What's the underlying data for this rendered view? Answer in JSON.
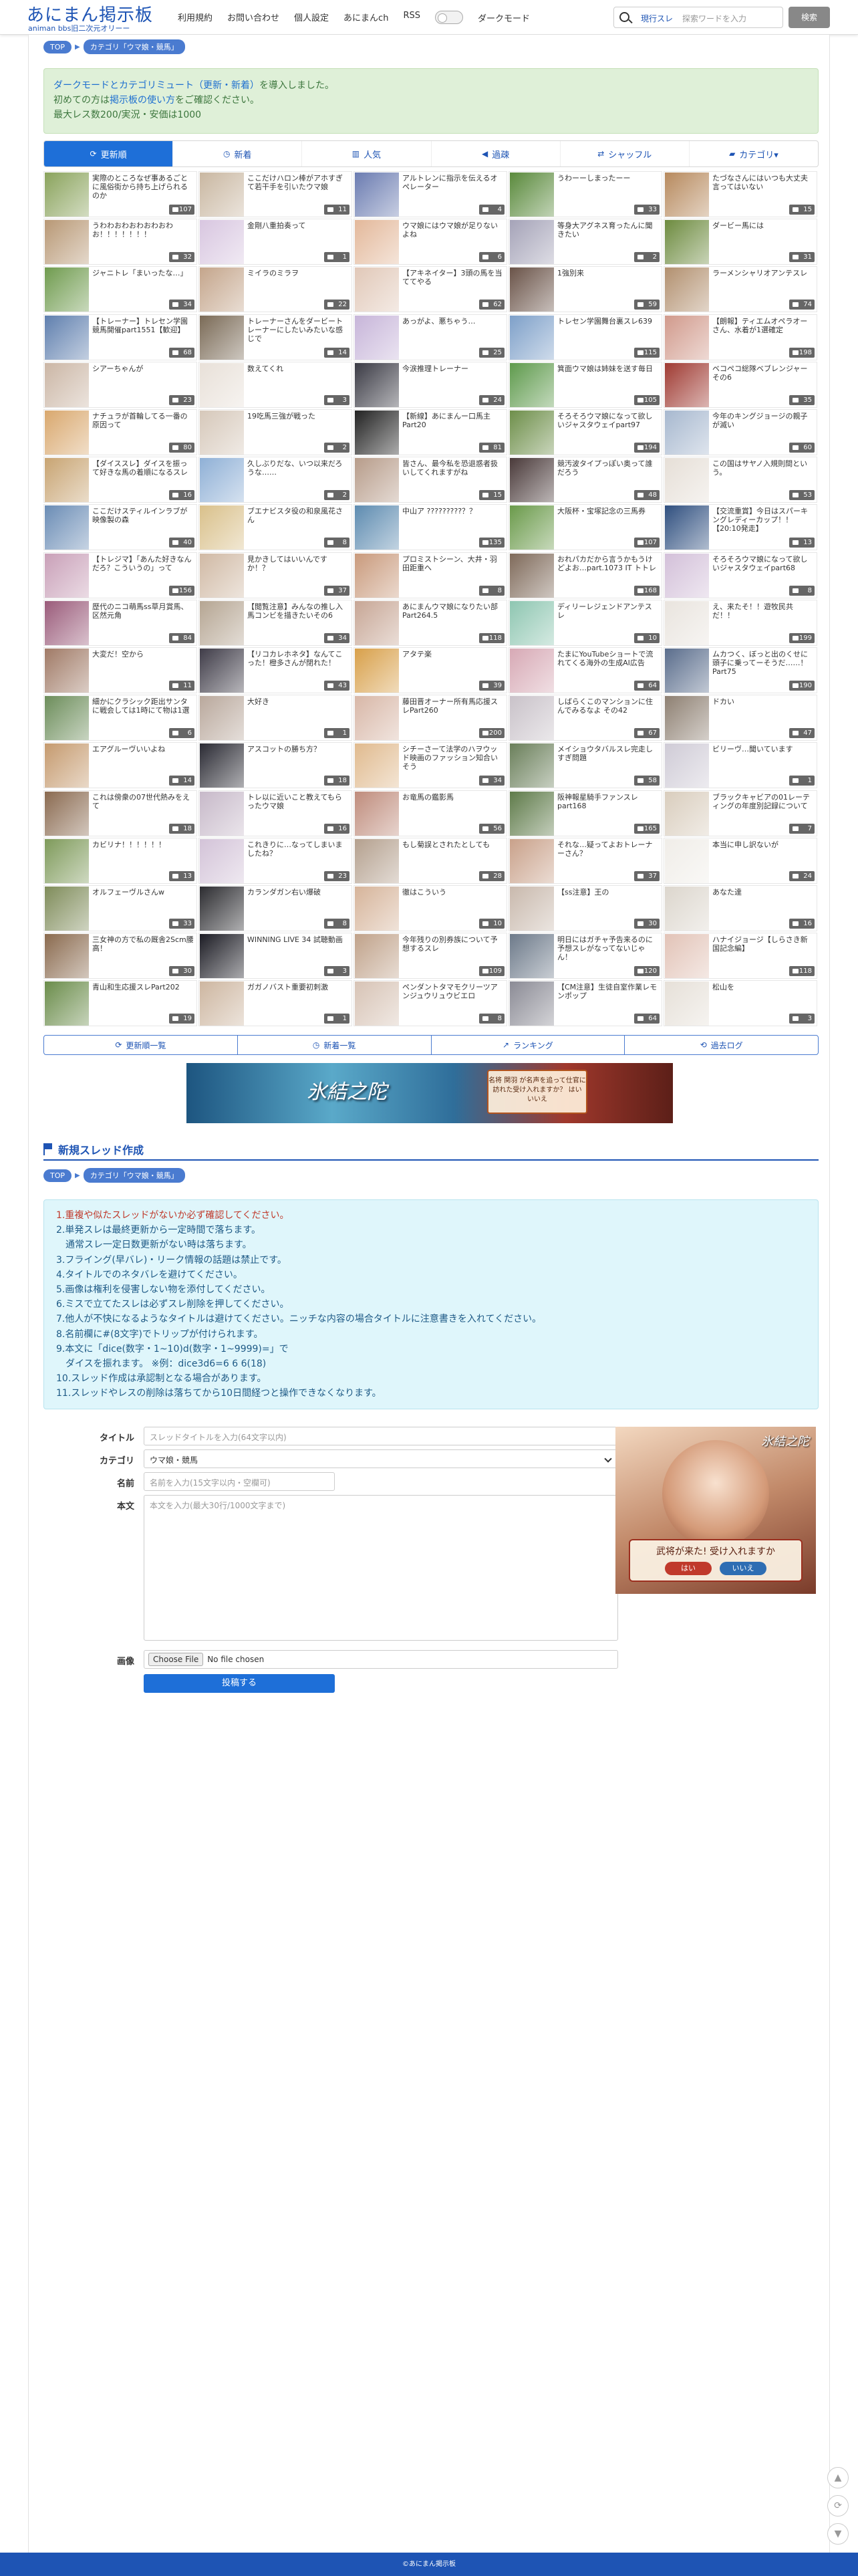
{
  "header": {
    "logo_main": "あにまん掲示板",
    "logo_sub": "animan bbs旧二次元オリーー",
    "nav": [
      "利用規約",
      "お問い合わせ",
      "個人設定",
      "あにまんch",
      "RSS"
    ],
    "darkmode_label": "ダークモード",
    "search_scope": "現行スレ",
    "search_placeholder": "探索ワードを入力",
    "search_button": "検索"
  },
  "breadcrumb": {
    "top": "TOP",
    "category": "カテゴリ「ウマ娘・競馬」"
  },
  "notice": {
    "line1_link": "ダークモードとカテゴリミュート（更新・新着）",
    "line1_rest": "を導入しました。",
    "line2_pre": "初めての方は",
    "line2_link": "掲示板の使い方",
    "line2_post": "をご確認ください。",
    "line3": "最大レス数200/実況・安価は1000"
  },
  "tabs": [
    {
      "label": "更新順",
      "icon": "refresh-icon",
      "active": true
    },
    {
      "label": "新着",
      "icon": "clock-icon",
      "active": false
    },
    {
      "label": "人気",
      "icon": "bar-chart-icon",
      "active": false
    },
    {
      "label": "過疎",
      "icon": "speaker-icon",
      "active": false
    },
    {
      "label": "シャッフル",
      "icon": "shuffle-icon",
      "active": false
    },
    {
      "label": "カテゴリ▾",
      "icon": "folder-icon",
      "active": false
    }
  ],
  "threads": [
    {
      "t": "実際のところなぜ事あるごとに風俗街から持ち上げられるのか",
      "n": "107",
      "c": "#8aa35c"
    },
    {
      "t": "ここだけハロン棒がアホすぎて若干手を引いたウマ娘",
      "n": "11",
      "c": "#c9b7a1"
    },
    {
      "t": "アルトレンに指示を伝えるオペレーター",
      "n": "4",
      "c": "#6b7cb1"
    },
    {
      "t": "うわーーしまったーー",
      "n": "33",
      "c": "#5a8a3c"
    },
    {
      "t": "たづなさんにはいつも大丈夫言ってはいない",
      "n": "15",
      "c": "#b78a5e"
    },
    {
      "t": "うわわおわおわおわおわお！！！！！！！",
      "n": "32",
      "c": "#b89875"
    },
    {
      "t": "金剛八重拍奏って",
      "n": "1",
      "c": "#d8c6e0"
    },
    {
      "t": "ウマ娘にはウマ娘が足りないよね",
      "n": "6",
      "c": "#e3b89a"
    },
    {
      "t": "等身大アグネス育ったんに聞きたい",
      "n": "2",
      "c": "#a5a3b8"
    },
    {
      "t": "ダービー馬には",
      "n": "31",
      "c": "#6d8b3f"
    },
    {
      "t": "ジャニトレ「まいったな…」",
      "n": "34",
      "c": "#6f9b4e"
    },
    {
      "t": "ミイラのミラヲ",
      "n": "22",
      "c": "#c4a58b"
    },
    {
      "t": "【アキネイター】3頭の馬を当ててやる",
      "n": "62",
      "c": "#e1c8b8"
    },
    {
      "t": "1強別来",
      "n": "59",
      "c": "#6a5348"
    },
    {
      "t": "ラーメンシャリオアンテスレ",
      "n": "74",
      "c": "#b2906f"
    },
    {
      "t": "【トレーナー】トレセン学園競馬開催part1551【歓迎】",
      "n": "68",
      "c": "#5f7fae"
    },
    {
      "t": "トレーナーさんをダービートレーナーにしたいみたいな感じで",
      "n": "14",
      "c": "#7a6a56"
    },
    {
      "t": "あっがよ、悪ちゃう…",
      "n": "25",
      "c": "#c7b5d9"
    },
    {
      "t": "トレセン学園舞台裏スレ639",
      "n": "115",
      "c": "#7ea0c9"
    },
    {
      "t": "【朗報】ティエムオペラオーさん、水着が1選確定",
      "n": "198",
      "c": "#d19a8c"
    },
    {
      "t": "シアーちゃんが",
      "n": "23",
      "c": "#cbb6a5"
    },
    {
      "t": "数えてくれ",
      "n": "3",
      "c": "#e8e0d8"
    },
    {
      "t": "今涙推理トレーナー",
      "n": "24",
      "c": "#3a3a44"
    },
    {
      "t": "箕面ウマ娘は姉妹を送す毎日",
      "n": "105",
      "c": "#5e9a4c"
    },
    {
      "t": "ベコペコ総隊ベブレンジャーその6",
      "n": "35",
      "c": "#9f3a32"
    },
    {
      "t": "ナチュラが首輪してる一番の原因って",
      "n": "80",
      "c": "#d9a86e"
    },
    {
      "t": "19吃馬三強が戦った",
      "n": "2",
      "c": "#d6c8ba"
    },
    {
      "t": "【新線】あにまんー口馬主 Part20",
      "n": "81",
      "c": "#222222"
    },
    {
      "t": "そろそろウマ娘になって欲しいジャスタウェイpart97",
      "n": "194",
      "c": "#6e8f4a"
    },
    {
      "t": "今年のキングジョージの親子が滅い",
      "n": "60",
      "c": "#a7b8cf"
    },
    {
      "t": "【ダイススレ】ダイスを振って好きな馬の着順になるスレ",
      "n": "16",
      "c": "#c8a472"
    },
    {
      "t": "久しぶりだな、いつ以来だろうな……",
      "n": "2",
      "c": "#8fb0d6"
    },
    {
      "t": "皆さん、最今私を恐退惑者扱いしてくれますがね",
      "n": "15",
      "c": "#b79c8a"
    },
    {
      "t": "競汚波タイプっぽい奥って誰だろう",
      "n": "48",
      "c": "#4a3a3a"
    },
    {
      "t": "この国はサヤノ入規則間という。",
      "n": "53",
      "c": "#e6dfd7"
    },
    {
      "t": "ここだけスティルインラブが映像製の森",
      "n": "40",
      "c": "#6a8cb5"
    },
    {
      "t": "ブエナビスタ役の和泉風花さん",
      "n": "8",
      "c": "#d9c08a"
    },
    {
      "t": "中山ア ?????????？？",
      "n": "135",
      "c": "#5d8bb0"
    },
    {
      "t": "大阪杯・宝塚記念の三馬券",
      "n": "107",
      "c": "#6a9a4a"
    },
    {
      "t": "【交流重賞】今日はスパーキングレディーカップ！！【20:10発走】",
      "n": "13",
      "c": "#2f4f7f"
    },
    {
      "t": "【トレジマ】「あんた好きなんだろ？こういうの」って",
      "n": "156",
      "c": "#c9a0b8"
    },
    {
      "t": "見かきしてはいいんですか！？",
      "n": "37",
      "c": "#d0b9a4"
    },
    {
      "t": "プロミストシーン、大井・羽田距重へ",
      "n": "8",
      "c": "#c99a7c"
    },
    {
      "t": "おれパカだから言うかもうけどよお…part.1073 IT トトレ",
      "n": "168",
      "c": "#7f6a5a"
    },
    {
      "t": "そろそろウマ娘になって欲しいジャスタウェイpart68",
      "n": "8",
      "c": "#d3c0d9"
    },
    {
      "t": "歴代のニコ萌馬ss草月賞馬、区然元角",
      "n": "84",
      "c": "#9a5b7a"
    },
    {
      "t": "【閲覧注意】みんなの推し入馬コンビを描きたいその6",
      "n": "34",
      "c": "#b5a592"
    },
    {
      "t": "あにまんウマ娘になりたい部Part264.5",
      "n": "118",
      "c": "#c7a695"
    },
    {
      "t": "ディリーレジェンドアンテスレ",
      "n": "10",
      "c": "#8ec6b1"
    },
    {
      "t": "え、来たそ！！遊牧民共だ！！",
      "n": "199",
      "c": "#e9e4de"
    },
    {
      "t": "大変だ！空から",
      "n": "11",
      "c": "#a07a66"
    },
    {
      "t": "【リコカレホネタ】なんてこった！橙多さんが閉れた！",
      "n": "43",
      "c": "#3f3c48"
    },
    {
      "t": "アタテ楽",
      "n": "39",
      "c": "#d8a04a"
    },
    {
      "t": "たまにYouTubeショートで流れてくる海外の生成AI広告",
      "n": "64",
      "c": "#d7a9b5"
    },
    {
      "t": "ムカつく、ぼっと出のくせに頭子に乗ってーそうだ……！Part75",
      "n": "190",
      "c": "#5a6d8c"
    },
    {
      "t": "細かにクラシック距出サンタに戦会しては1時にて物は1選",
      "n": "6",
      "c": "#6c8d5a"
    },
    {
      "t": "大好き",
      "n": "1",
      "c": "#b9a89c"
    },
    {
      "t": "藤田晋オーナー所有馬応援スレPart260",
      "n": "200",
      "c": "#d8b7a7"
    },
    {
      "t": "しばらくこのマンションに住んでみるなよ その42",
      "n": "67",
      "c": "#c9c2c9"
    },
    {
      "t": "ドカい",
      "n": "47",
      "c": "#8e8072"
    },
    {
      "t": "エアグルーヴいいよね",
      "n": "14",
      "c": "#c59a6e"
    },
    {
      "t": "アスコットの勝ち方？",
      "n": "18",
      "c": "#2a2a33"
    },
    {
      "t": "シチーさーて法学のハヲウッド映画のファッション知合いそう",
      "n": "34",
      "c": "#e0ba8e"
    },
    {
      "t": "メイショウタバルスレ完走しすぎ問題",
      "n": "58",
      "c": "#6a7f5a"
    },
    {
      "t": "ビリーヴ…聞いています",
      "n": "1",
      "c": "#cfcbd6"
    },
    {
      "t": "これは傍衆の07世代熱みをえて",
      "n": "18",
      "c": "#8a6a50"
    },
    {
      "t": "トレ以に近いこと教えてもらったウマ娘",
      "n": "16",
      "c": "#c7b9c9"
    },
    {
      "t": "お竜馬の鑑影馬",
      "n": "56",
      "c": "#bf8c7c"
    },
    {
      "t": "阪神報星騎手ファンスレpart168",
      "n": "165",
      "c": "#5f7b4a"
    },
    {
      "t": "ブラックキャビアの01レーティングの年度別記録について",
      "n": "7",
      "c": "#d9cdbd"
    },
    {
      "t": "カビリナ！！！！！！",
      "n": "13",
      "c": "#7e9a5a"
    },
    {
      "t": "これきりに…なってしまいましたね？",
      "n": "23",
      "c": "#d3c3d8"
    },
    {
      "t": "もし菊誤とされたとしても",
      "n": "28",
      "c": "#b4a08e"
    },
    {
      "t": "それな…疑ってよおトレーナーさん？",
      "n": "37",
      "c": "#c9a18a"
    },
    {
      "t": "本当に申し訳ないが",
      "n": "24",
      "c": "#f0ede8"
    },
    {
      "t": "オルフェーヴルさんw",
      "n": "33",
      "c": "#7f8c5a"
    },
    {
      "t": "カランダガン右い爆破",
      "n": "8",
      "c": "#2c2c30"
    },
    {
      "t": "徹はこういう",
      "n": "10",
      "c": "#d6b49a"
    },
    {
      "t": "【ss注意】王の",
      "n": "30",
      "c": "#c9b9ad"
    },
    {
      "t": "あなた達",
      "n": "16",
      "c": "#dcd6cd"
    },
    {
      "t": "三女神の方で私の厩舎2Scm腰高！",
      "n": "30",
      "c": "#8a6a4e"
    },
    {
      "t": "WINNING LIVE 34 試聴動画",
      "n": "3",
      "c": "#1c1c24"
    },
    {
      "t": "今年残りの別券族について予想するスレ",
      "n": "109",
      "c": "#c0a28a"
    },
    {
      "t": "明日にはガチャ予告来るのに予想スレがなってないじゃん！",
      "n": "120",
      "c": "#6d7a8a"
    },
    {
      "t": "ハナイジョージ【しらさき新国記念編】",
      "n": "118",
      "c": "#e2c3b7"
    },
    {
      "t": "青山和生応援スレPart202",
      "n": "19",
      "c": "#6a8c4a"
    },
    {
      "t": "ガガノバスト重要初刺激",
      "n": "1",
      "c": "#cdb6a0"
    },
    {
      "t": "ペンダントタマモクリーツアンジュウリュウビエロ",
      "n": "8",
      "c": "#d7c3b5"
    },
    {
      "t": "【CM注意】生徒自室作業レモンポップ",
      "n": "64",
      "c": "#8b8b95"
    },
    {
      "t": "松山を",
      "n": "3",
      "c": "#e6e0d8"
    }
  ],
  "bottom_nav": [
    {
      "label": "更新順一覧",
      "icon": "refresh-icon"
    },
    {
      "label": "新着一覧",
      "icon": "clock-icon"
    },
    {
      "label": "ランキング",
      "icon": "chart-icon"
    },
    {
      "label": "過去ログ",
      "icon": "history-icon"
    }
  ],
  "banner1": {
    "title": "氷結之陀",
    "box": "名将 関羽 が名声を追って仕官に訪れた受け入れますか？ はい いいえ"
  },
  "section_title": "新規スレッド作成",
  "rules": [
    "1.重複や似たスレッドがないか必ず確認してください。",
    "2.単発スレは最終更新から一定時間で落ちます。",
    "　通常スレ一定日数更新がない時は落ちます。",
    "3.フライング(早バレ)・リーク情報の話題は禁止です。",
    "4.タイトルでのネタバレを避けてください。",
    "5.画像は権利を侵害しない物を添付してください。",
    "6.ミスで立てたスレは必ずスレ削除を押してください。",
    "7.他人が不快になるようなタイトルは避けてください。ニッチな内容の場合タイトルに注意書きを入れてください。",
    "8.名前欄に#(8文字)でトリップが付けられます。",
    "9.本文に「dice(数字・1~10)d(数字・1~9999)=」で",
    "　ダイスを振れます。 ※例：dice3d6=6 6 6(18)",
    "10.スレッド作成は承認制となる場合があります。",
    "11.スレッドやレスの削除は落ちてから10日間経つと操作できなくなります。"
  ],
  "form": {
    "title_label": "タイトル",
    "title_placeholder": "スレッドタイトルを入力(64文字以内)",
    "category_label": "カテゴリ",
    "category_value": "ウマ娘・競馬",
    "name_label": "名前",
    "name_placeholder": "名前を入力(15文字以内・空欄可)",
    "body_label": "本文",
    "body_placeholder": "本文を入力(最大30行/1000文字まで)",
    "image_label": "画像",
    "file_button": "Choose File",
    "file_status": "No file chosen",
    "submit": "投稿する"
  },
  "ad2": {
    "title": "氷結之陀",
    "question": "武将が来た! 受け入れますか",
    "yes": "はい",
    "no": "いいえ"
  },
  "footer": "©あにまん掲示板"
}
